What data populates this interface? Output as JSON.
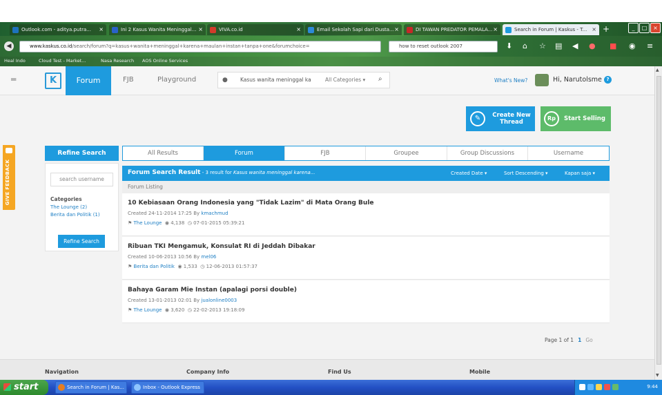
{
  "browser": {
    "tabs": [
      {
        "label": "Outlook.com - aditya.putra...",
        "icon_color": "#1e73be"
      },
      {
        "label": "Ini 2 Kasus Wanita Meninggal...",
        "icon_color": "#2a62c9"
      },
      {
        "label": "VIVA.co.id",
        "icon_color": "#d23b2b"
      },
      {
        "label": "Email Sekolah Sapi dari Dusta...",
        "icon_color": "#2d8ad8"
      },
      {
        "label": "DI TAWAN PREDATOR PEMALA...",
        "icon_color": "#c62828"
      },
      {
        "label": "Search in Forum | Kaskus - T...",
        "icon_color": "#ffffff",
        "active": true
      }
    ],
    "new_tab": "+",
    "url_domain": "www.kaskus.co.id",
    "url_path": "/search/forum?q=kasus+wanita+meninggal+karena+maulan+instan+tanpa+one&forumchoice=",
    "search_placeholder": "how to reset outlook 2007",
    "bookmarks": [
      "Heal Indo",
      "Cloud Test - Market...",
      "Nasa Research",
      "AOS Online Services"
    ]
  },
  "kaskus_nav": {
    "forum": "Forum",
    "fjb": "FJB",
    "playground": "Playground",
    "search_query": "Kasus wanita meninggal ka",
    "category": "All Categories",
    "whats_new": "What's New?",
    "greeting": "Hi, Narutolsme"
  },
  "actions": {
    "create_thread": "Create New Thread",
    "start_selling": "Start Selling",
    "rp": "Rp"
  },
  "feedback": "GIVE FEEDBACK",
  "sidebar": {
    "refine_title": "Refine Search",
    "username_placeholder": "search username",
    "categories_label": "Categories",
    "categories": [
      "The Lounge (2)",
      "Berita dan Politik (1)"
    ],
    "refine_button": "Refine Search"
  },
  "tabs": [
    "All Results",
    "Forum",
    "FJB",
    "Groupee",
    "Group Discussions",
    "Username"
  ],
  "results_header": {
    "title": "Forum Search Result",
    "summary": " - 3 result for ",
    "query": "Kasus wanita meninggal karena...",
    "sort_field": "Created Date",
    "sort_order": "Sort Descending",
    "time": "Kapan saja"
  },
  "listing_label": "Forum Listing",
  "results": [
    {
      "title": "10 Kebiasaan Orang Indonesia yang \"Tidak Lazim\" di Mata Orang Bule",
      "created": "Created 24-11-2014 17:25 By ",
      "user": "kmachmud",
      "forum": "The Lounge",
      "views": "4,138",
      "last": "07-01-2015 05:39:21"
    },
    {
      "title": "Ribuan TKI Mengamuk, Konsulat RI di Jeddah Dibakar",
      "created": "Created 10-06-2013 10:56 By ",
      "user": "mel06",
      "forum": "Berita dan Politik",
      "views": "1,533",
      "last": "12-06-2013 01:57:37"
    },
    {
      "title": "Bahaya Garam Mie Instan (apalagi porsi double)",
      "created": "Created 13-01-2013 02:01 By ",
      "user": "jualonline0003",
      "forum": "The Lounge",
      "views": "3,620",
      "last": "22-02-2013 19:18:09"
    }
  ],
  "pagination": {
    "label": "Page 1 of 1",
    "current": "1",
    "go": "Go"
  },
  "footer": [
    "Navigation",
    "Company Info",
    "Find Us",
    "Mobile"
  ],
  "taskbar": {
    "start": "start",
    "tasks": [
      "Search in Forum | Kas...",
      "Inbox - Outlook Express"
    ],
    "clock": "9:44"
  },
  "colors": {
    "accent": "#1e9bde",
    "sell": "#5dbb6a",
    "feedback": "#f5a623"
  }
}
